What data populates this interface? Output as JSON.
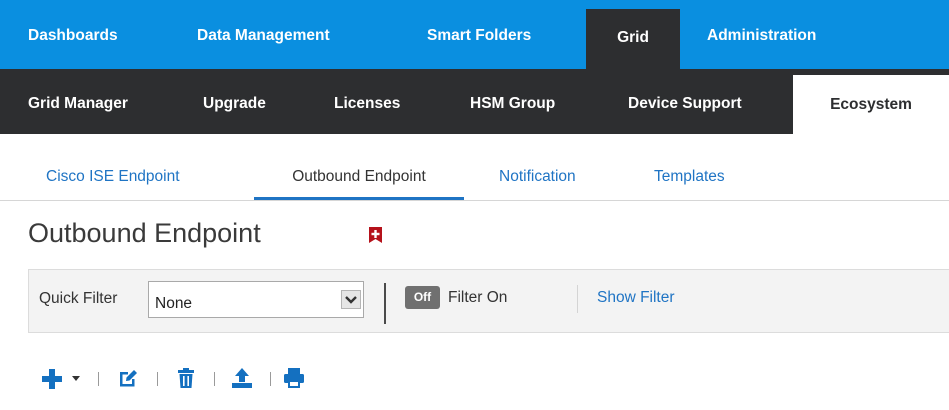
{
  "top_nav": {
    "items": [
      "Dashboards",
      "Data Management",
      "Smart Folders",
      "Grid",
      "Administration"
    ],
    "active": "Grid"
  },
  "sub_nav": {
    "items": [
      "Grid Manager",
      "Upgrade",
      "Licenses",
      "HSM Group",
      "Device Support",
      "Ecosystem"
    ],
    "active": "Ecosystem"
  },
  "tabs": {
    "items": [
      "Cisco ISE Endpoint",
      "Outbound Endpoint",
      "Notification",
      "Templates"
    ],
    "active": "Outbound Endpoint"
  },
  "page": {
    "title": "Outbound Endpoint"
  },
  "filter_bar": {
    "quick_filter_label": "Quick Filter",
    "quick_filter_value": "None",
    "toggle_label": "Off",
    "filter_on_label": "Filter On",
    "show_filter_label": "Show Filter"
  },
  "toolbar": {
    "icons": [
      "add-icon",
      "dropdown-caret-icon",
      "edit-icon",
      "delete-icon",
      "upload-icon",
      "print-icon"
    ]
  },
  "colors": {
    "top_nav_bg": "#0a8fe0",
    "sub_nav_bg": "#2d2e30",
    "link_blue": "#1f74c4",
    "bookmark_red": "#b5121b",
    "icon_blue": "#1470c0"
  }
}
